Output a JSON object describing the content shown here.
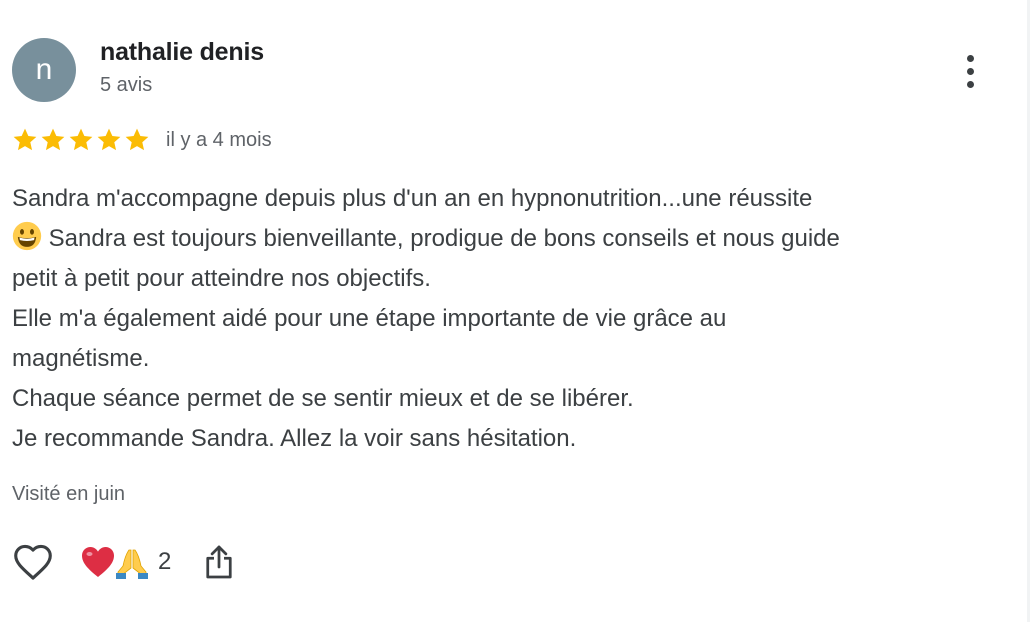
{
  "review": {
    "author": {
      "initial": "n",
      "name": "nathalie denis",
      "meta": "5 avis",
      "avatar_color": "#78909c"
    },
    "menu_icon": "more-vertical-icon",
    "rating": 5,
    "rating_max": 5,
    "star_color": "#fbbc04",
    "date": "il y a 4 mois",
    "text_lines": [
      "Sandra m'accompagne depuis plus d'un an en hypnonutrition...une réussite",
      "Sandra est toujours bienveillante, prodigue de bons conseils et nous guide",
      "petit à petit pour atteindre nos objectifs.",
      "Elle m'a également aidé pour une étape importante de vie grâce au",
      "magnétisme.",
      "Chaque séance permet de se sentir mieux et de se libérer.",
      "Je recommande Sandra. Allez la voir sans hésitation."
    ],
    "inline_emoji": "grinning-face-emoji",
    "visited": "Visité en juin",
    "actions": {
      "like_icon": "heart-outline-icon",
      "reaction_icons": [
        "red-heart-emoji",
        "folded-hands-emoji"
      ],
      "reaction_count": "2",
      "share_icon": "share-icon"
    }
  }
}
